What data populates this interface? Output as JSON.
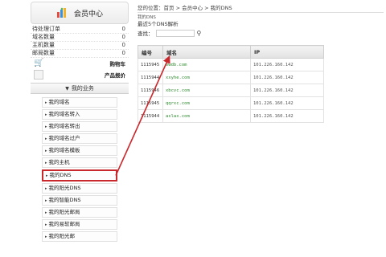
{
  "sidebar": {
    "title": "会员中心",
    "stats": [
      {
        "label": "待处理订单",
        "value": "0"
      },
      {
        "label": "域名数量",
        "value": "0"
      },
      {
        "label": "主机数量",
        "value": "0"
      },
      {
        "label": "邮局数量",
        "value": "0"
      }
    ],
    "cart_label": "购物车",
    "price_label": "产品报价",
    "section_title": "我的业务",
    "menu": [
      "我的域名",
      "我的域名转入",
      "我的域名转出",
      "我的域名过户",
      "我的域名模板",
      "我的主机",
      "我的DNS",
      "我的阳光DNS",
      "我的智能DNS",
      "我的阳光邮局",
      "我的易软邮局",
      "我的阳光邮"
    ],
    "active_index": 6
  },
  "main": {
    "breadcrumb": "您的位置：首页 > 会员中心 > 我的DNS",
    "small_title": "我的DNS",
    "latest_label": "最近5个DNS解析",
    "search_label": "查找：",
    "table": {
      "headers": [
        "编号",
        "域名",
        "IP"
      ],
      "rows": [
        [
          "1115945",
          "ewdb.com",
          "101.226.160.142"
        ],
        [
          "1115944",
          "xxyhe.com",
          "101.226.160.142"
        ],
        [
          "1115946",
          "xbcvc.com",
          "101.226.160.142"
        ],
        [
          "1115945",
          "qqrxc.com",
          "101.226.160.142"
        ],
        [
          "1115944",
          "aslax.com",
          "101.226.160.142"
        ]
      ]
    }
  },
  "colors": {
    "highlight_red": "#c9282d",
    "domain_green": "#2e8b2e"
  }
}
